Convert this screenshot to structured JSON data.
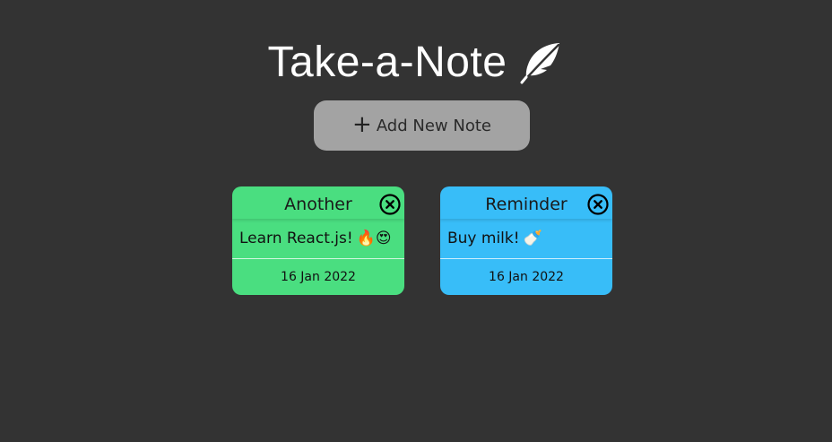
{
  "app": {
    "title": "Take-a-Note",
    "title_icon": "feather-icon"
  },
  "toolbar": {
    "add_label": "Add New Note",
    "add_icon": "plus-icon"
  },
  "notes": [
    {
      "title": "Another",
      "body": "Learn React.js!",
      "emoji": "🔥😍",
      "date": "16 Jan 2022",
      "color": "#4ade80"
    },
    {
      "title": "Reminder",
      "body": "Buy milk!",
      "emoji": "🍼",
      "date": "16 Jan 2022",
      "color": "#38bdf8"
    }
  ],
  "colors": {
    "background": "#333333",
    "button": "#a3a3a3",
    "text_light": "#ffffff"
  }
}
